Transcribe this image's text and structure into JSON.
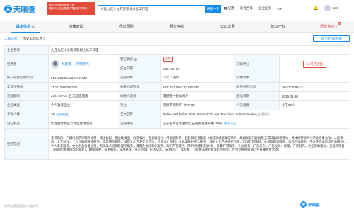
{
  "header": {
    "logo_text": "天眼查",
    "logo_mark": "天",
    "logo_sub": "TianYanCha.com",
    "promo": [
      "都在用的商业查询工具",
      "国家中小企业发展子基金旗下机构"
    ],
    "search_value": "大连九亿少女的梦影视文化工作室",
    "search_button": "天眼一下",
    "app_label": "应用",
    "nav": [
      "商务合作",
      "企业业务",
      "VIP"
    ],
    "user_num": "186"
  },
  "tabs": [
    {
      "label": "基本信息",
      "count": "14"
    },
    {
      "label": "法律诉讼",
      "count": ""
    },
    {
      "label": "经营风险",
      "count": ""
    },
    {
      "label": "经营信息",
      "count": ""
    },
    {
      "label": "公司发展",
      "count": ""
    },
    {
      "label": "知识产权",
      "count": ""
    },
    {
      "label": "历史信息",
      "count": "2"
    }
  ],
  "hot_badge": "热",
  "subtabs": [
    {
      "label": "工商信息",
      "count": ""
    },
    {
      "label": "历史工商信息",
      "count": "2"
    }
  ],
  "report_button": "工商官网快照",
  "info": {
    "l_name": "企业名称",
    "name": "大连九亿少女的梦影视文化工作室",
    "l_legal": "经营者",
    "legal_name": "林夏鹏",
    "legal_tag": "实际控制人",
    "l_status": "登记状态",
    "status": "注销",
    "l_date": "成立日期",
    "date": "2021-09-03",
    "l_tyc": "天眼评分",
    "seal": "公司已注销",
    "l_credit": "统一社会信用代码",
    "credit": "91210213MA11CX4P43E",
    "l_capital": "注册资本",
    "capital": "10万人民币",
    "l_paid": "实缴资本",
    "paid": "-",
    "l_reg": "工商注册号",
    "reg": "210213000632025",
    "l_tax": "纳税人识别号",
    "tax": "91210213MA11CX4P43E",
    "l_org": "组织机构代码",
    "org": "MA11CX4P4-3",
    "l_term": "营业期限",
    "term": "2021-09-03 至 无固定期限",
    "l_taxq": "纳税人资质",
    "taxq": "增值税一般纳税人",
    "l_approve": "核准日期",
    "approve": "2026-01-30",
    "l_type": "企业类型",
    "type": "个人独资企业",
    "l_industry": "行业",
    "industry": "影视节目制作（P8730）",
    "l_scale": "人员规模",
    "scale": "小于50人",
    "l_insured": "参保人数",
    "insured": "12",
    "insured_tag": "2024年报",
    "l_en": "英文名称",
    "en": "Dalian 900 Million Girls' Dream Film and Television Culture Studio",
    "en_note": "(自动翻译)",
    "l_authority": "登记机关",
    "authority": "大连金普新区市场监督管理局",
    "l_address": "注册地址",
    "address": "辽宁省大连市金州区石河街道春海路188号",
    "map": "附近公司",
    "l_scope": "经营范围",
    "scope": "许可项目：广播电视节目制作经营，演出经纪，营业性演出，电影发行，电视剧发行，电视剧制作，互联网信息服务（依法须经批准的项目，经相关部门批准后方可开展经营活动，具体经营项目以审批结果为准）一般项目：文艺创作，个人互联网直播服务，电影摄制服务，组织文化艺术交流活动，专业设计服务，文化娱乐经纪人服务，其他文化艺术经纪代理，市场营销策划，会议及展览服务，信息咨询服务（不含许可类信息咨询服务），个人商务服务，文化用品设备出租，影视美术道具及服装服务，摄像及视频制作服务，知识产权服务（专利代理服务除外），摄影扩印服务，礼仪服务，广告发布，广告设计、代理，广告制作，企业形象策划，互联网销售（除销售需要许可的商品），翻译服务，技术服务、技术开发、技术咨询、技术交流、技术转让、技术推广（除依法须经批准的项目外，凭营业执照依法自主开展经营活动）"
  },
  "footer_left": "北京金堤征信服务有限公司",
  "footer_brand": "天眼查"
}
